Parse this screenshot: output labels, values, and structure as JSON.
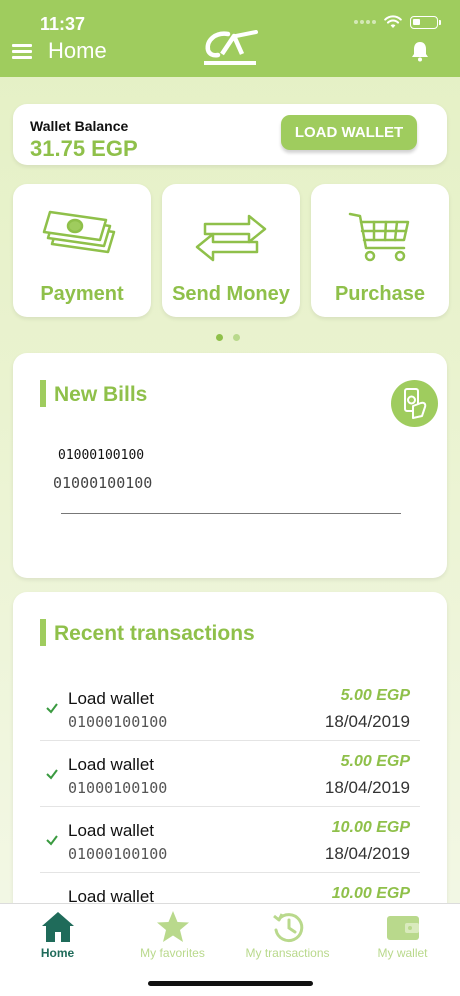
{
  "status": {
    "time": "11:37"
  },
  "header": {
    "title": "Home"
  },
  "wallet": {
    "label": "Wallet Balance",
    "amount": "31.75 EGP",
    "load_label": "LOAD WALLET"
  },
  "actions": [
    {
      "label": "Payment",
      "icon": "cash-icon"
    },
    {
      "label": "Send Money",
      "icon": "transfer-arrows-icon"
    },
    {
      "label": "Purchase",
      "icon": "cart-icon"
    }
  ],
  "pager": {
    "count": 2,
    "active": 0
  },
  "bills": {
    "title": "New Bills",
    "code_primary": "01000100100",
    "code_secondary": "01000100100"
  },
  "transactions": {
    "title": "Recent transactions",
    "items": [
      {
        "title": "Load wallet",
        "account": "01000100100",
        "amount": "5.00 EGP",
        "date": "18/04/2019"
      },
      {
        "title": "Load wallet",
        "account": "01000100100",
        "amount": "5.00 EGP",
        "date": "18/04/2019"
      },
      {
        "title": "Load wallet",
        "account": "01000100100",
        "amount": "10.00 EGP",
        "date": "18/04/2019"
      },
      {
        "title": "Load wallet",
        "account": "",
        "amount": "10.00 EGP",
        "date": ""
      }
    ]
  },
  "tabs": [
    {
      "label": "Home",
      "icon": "home-icon",
      "active": true
    },
    {
      "label": "My favorites",
      "icon": "star-icon",
      "active": false
    },
    {
      "label": "My transactions",
      "icon": "history-clock-icon",
      "active": false
    },
    {
      "label": "My wallet",
      "icon": "wallet-icon",
      "active": false
    }
  ],
  "colors": {
    "brand_green": "#9fcc5e",
    "accent_green": "#8fc04a",
    "active_tab": "#1f6b5a",
    "inactive_tab": "#b9d98c"
  }
}
